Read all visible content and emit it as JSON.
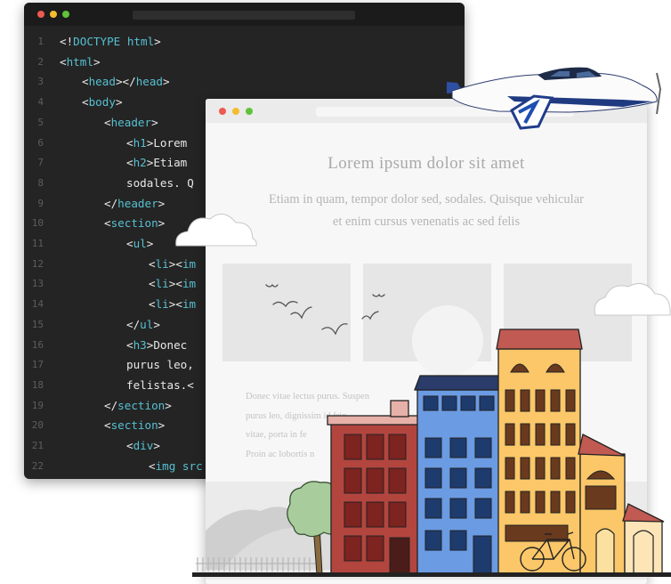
{
  "editor": {
    "lines": [
      {
        "n": "1",
        "parts": [
          {
            "t": "<!",
            "c": "p"
          },
          {
            "t": "DOCTYPE html",
            "c": "tag"
          },
          {
            "t": ">",
            "c": "p"
          }
        ]
      },
      {
        "n": "2",
        "parts": [
          {
            "t": "<",
            "c": "p"
          },
          {
            "t": "html",
            "c": "tag"
          },
          {
            "t": ">",
            "c": "p"
          }
        ]
      },
      {
        "n": "3",
        "parts": [
          {
            "t": "<",
            "c": "p"
          },
          {
            "t": "head",
            "c": "tag"
          },
          {
            "t": "></",
            "c": "p"
          },
          {
            "t": "head",
            "c": "tag"
          },
          {
            "t": ">",
            "c": "p"
          }
        ]
      },
      {
        "n": "4",
        "parts": [
          {
            "t": "<",
            "c": "p"
          },
          {
            "t": "body",
            "c": "tag"
          },
          {
            "t": ">",
            "c": "p"
          }
        ]
      },
      {
        "n": "5",
        "parts": [
          {
            "t": "<",
            "c": "p"
          },
          {
            "t": "header",
            "c": "tag"
          },
          {
            "t": ">",
            "c": "p"
          }
        ]
      },
      {
        "n": "6",
        "parts": [
          {
            "t": "<",
            "c": "p"
          },
          {
            "t": "h1",
            "c": "tag"
          },
          {
            "t": ">Lorem",
            "c": "p"
          }
        ]
      },
      {
        "n": "7",
        "parts": [
          {
            "t": "<",
            "c": "p"
          },
          {
            "t": "h2",
            "c": "tag"
          },
          {
            "t": ">Etiam",
            "c": "p"
          }
        ]
      },
      {
        "n": "8",
        "parts": [
          {
            "t": "sodales. Q",
            "c": "p"
          }
        ]
      },
      {
        "n": "9",
        "parts": [
          {
            "t": "</",
            "c": "p"
          },
          {
            "t": "header",
            "c": "tag"
          },
          {
            "t": ">",
            "c": "p"
          }
        ]
      },
      {
        "n": "10",
        "parts": [
          {
            "t": "<",
            "c": "p"
          },
          {
            "t": "section",
            "c": "tag"
          },
          {
            "t": ">",
            "c": "p"
          }
        ]
      },
      {
        "n": "11",
        "parts": [
          {
            "t": "<",
            "c": "p"
          },
          {
            "t": "ul",
            "c": "tag"
          },
          {
            "t": ">",
            "c": "p"
          }
        ]
      },
      {
        "n": "12",
        "parts": [
          {
            "t": "<",
            "c": "p"
          },
          {
            "t": "li",
            "c": "tag"
          },
          {
            "t": "><",
            "c": "p"
          },
          {
            "t": "im",
            "c": "tag"
          }
        ]
      },
      {
        "n": "13",
        "parts": [
          {
            "t": "<",
            "c": "p"
          },
          {
            "t": "li",
            "c": "tag"
          },
          {
            "t": "><",
            "c": "p"
          },
          {
            "t": "im",
            "c": "tag"
          }
        ]
      },
      {
        "n": "14",
        "parts": [
          {
            "t": "<",
            "c": "p"
          },
          {
            "t": "li",
            "c": "tag"
          },
          {
            "t": "><",
            "c": "p"
          },
          {
            "t": "im",
            "c": "tag"
          }
        ]
      },
      {
        "n": "15",
        "parts": [
          {
            "t": "</",
            "c": "p"
          },
          {
            "t": "ul",
            "c": "tag"
          },
          {
            "t": ">",
            "c": "p"
          }
        ]
      },
      {
        "n": "16",
        "parts": [
          {
            "t": "<",
            "c": "p"
          },
          {
            "t": "h3",
            "c": "tag"
          },
          {
            "t": ">Donec",
            "c": "p"
          }
        ]
      },
      {
        "n": "17",
        "parts": [
          {
            "t": "purus leo,",
            "c": "p"
          }
        ]
      },
      {
        "n": "18",
        "parts": [
          {
            "t": "felistas.<",
            "c": "p"
          }
        ]
      },
      {
        "n": "19",
        "parts": [
          {
            "t": "</",
            "c": "p"
          },
          {
            "t": "section",
            "c": "tag"
          },
          {
            "t": ">",
            "c": "p"
          }
        ]
      },
      {
        "n": "20",
        "parts": [
          {
            "t": "<",
            "c": "p"
          },
          {
            "t": "section",
            "c": "tag"
          },
          {
            "t": ">",
            "c": "p"
          }
        ]
      },
      {
        "n": "21",
        "parts": [
          {
            "t": "<",
            "c": "p"
          },
          {
            "t": "div",
            "c": "tag"
          },
          {
            "t": ">",
            "c": "p"
          }
        ]
      },
      {
        "n": "22",
        "parts": [
          {
            "t": "<",
            "c": "p"
          },
          {
            "t": "img src",
            "c": "tag"
          }
        ]
      }
    ]
  },
  "browser": {
    "title": "Lorem ipsum dolor sit amet",
    "subtitle_line1": "Etiam in quam, tempor dolor sed, sodales. Quisque vehicular",
    "subtitle_line2": "et enim cursus venenatis ac sed felis",
    "paragraph": [
      "Donec vitae lectus purus. Suspen",
      "purus leo, dignissim id frin",
      "vitae, porta in fe",
      "Proin ac lobortis n"
    ]
  },
  "colors": {
    "editor_bg": "#242424",
    "tag": "#56c0d2",
    "dot_red": "#ee5a52",
    "dot_yellow": "#f4bd2f",
    "dot_green": "#5fc339",
    "building_red": "#b3453f",
    "building_blue": "#6b9be2",
    "building_yellow": "#fbc768"
  },
  "icons": [
    "close-dot-icon",
    "minimize-dot-icon",
    "maximize-dot-icon",
    "airplane-icon",
    "cloud-icon",
    "bird-icon",
    "sun-icon",
    "tree-icon",
    "bicycle-icon"
  ]
}
